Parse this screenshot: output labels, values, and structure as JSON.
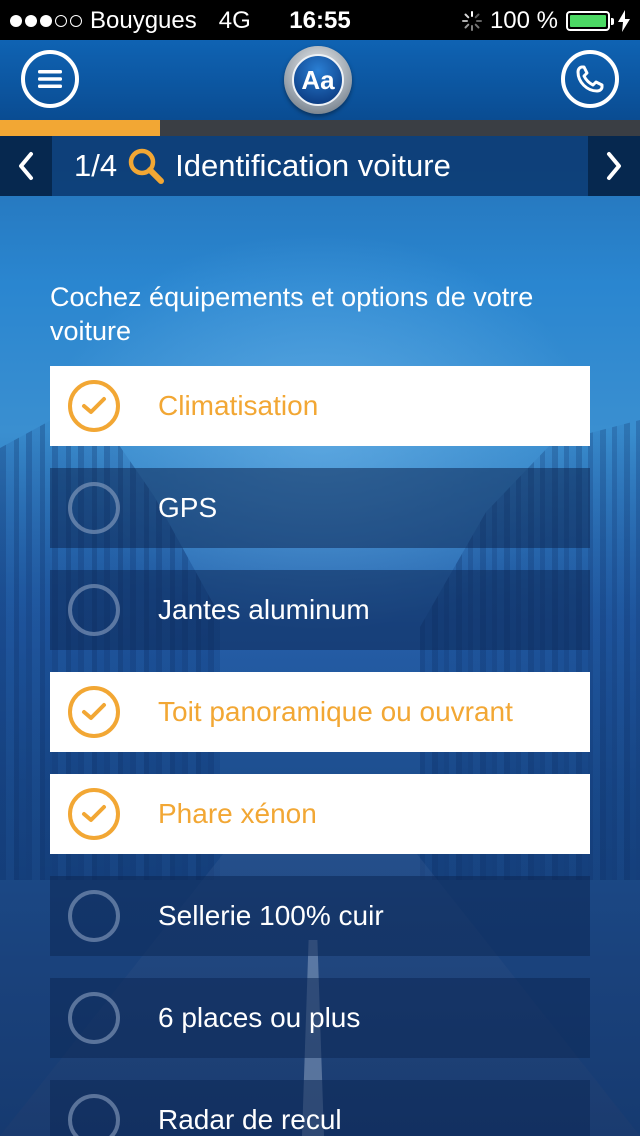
{
  "status_bar": {
    "carrier": "Bouygues",
    "network": "4G",
    "time": "16:55",
    "battery": "100 %",
    "signal_bars_filled": 3,
    "signal_bars_total": 5
  },
  "nav": {
    "logo_text": "Aa",
    "menu_icon": "menu-icon",
    "phone_icon": "phone-icon"
  },
  "progress": {
    "value": 0.25,
    "color": "#f2a734"
  },
  "step": {
    "counter": "1/4",
    "title": "Identification voiture",
    "icon": "search-icon"
  },
  "instruction": "Cochez équipements et options de votre voiture",
  "options": [
    {
      "label": "Climatisation",
      "checked": true
    },
    {
      "label": "GPS",
      "checked": false
    },
    {
      "label": "Jantes aluminum",
      "checked": false
    },
    {
      "label": "Toit panoramique ou ouvrant",
      "checked": true
    },
    {
      "label": "Phare xénon",
      "checked": true
    },
    {
      "label": "Sellerie 100% cuir",
      "checked": false
    },
    {
      "label": "6 places ou plus",
      "checked": false
    },
    {
      "label": "Radar de recul",
      "checked": false
    }
  ],
  "colors": {
    "accent": "#f2a734",
    "nav": "#0a4c92",
    "battery": "#4cd964"
  }
}
